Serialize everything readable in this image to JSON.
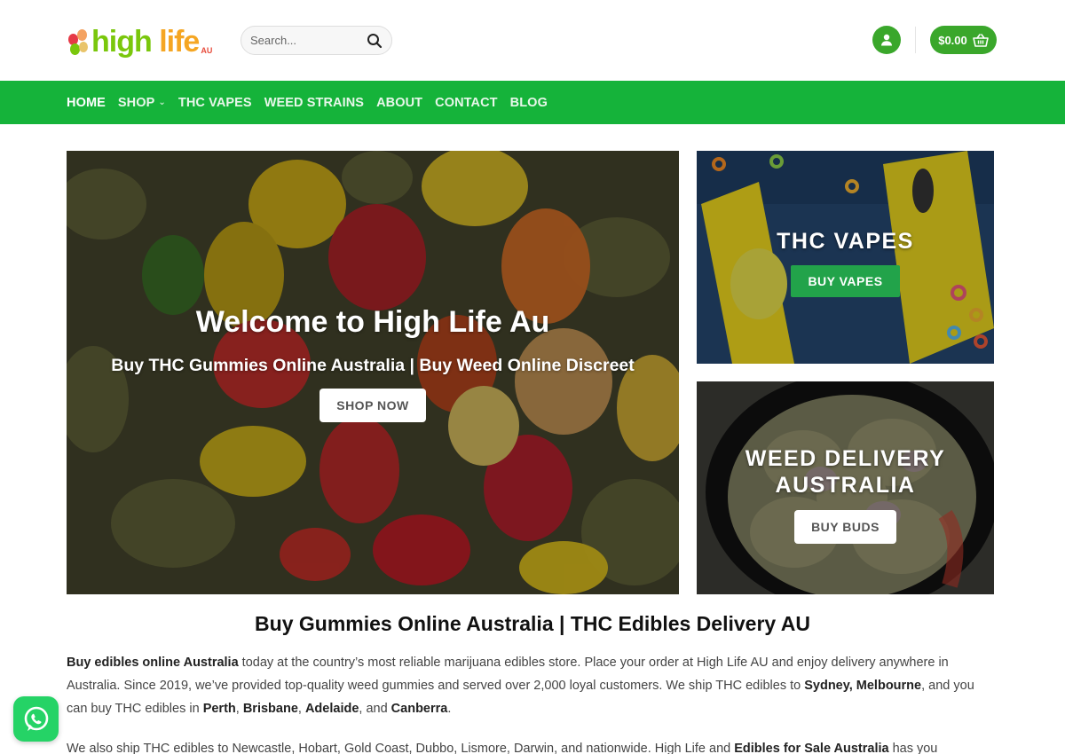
{
  "header": {
    "logo_text_high": "high",
    "logo_text_life": "life",
    "logo_au": "AU",
    "search_placeholder": "Search...",
    "cart_total": "$0.00"
  },
  "nav": {
    "items": [
      {
        "label": "HOME",
        "active": true
      },
      {
        "label": "SHOP",
        "has_dropdown": true
      },
      {
        "label": "THC VAPES"
      },
      {
        "label": "WEED STRAINS"
      },
      {
        "label": "ABOUT"
      },
      {
        "label": "CONTACT"
      },
      {
        "label": "BLOG"
      }
    ]
  },
  "hero": {
    "title": "Welcome to High Life Au",
    "subtitle": "Buy THC Gummies Online Australia | Buy Weed Online Discreet",
    "button": "SHOP NOW"
  },
  "side_banners": [
    {
      "title": "THC VAPES",
      "button": "BUY VAPES"
    },
    {
      "title_line1": "WEED DELIVERY",
      "title_line2": "AUSTRALIA",
      "button": "BUY BUDS"
    }
  ],
  "content": {
    "title": "Buy Gummies Online Australia | THC Edibles Delivery AU",
    "p1": {
      "s1": "Buy edibles online Australia",
      "s2": " today at the country’s most reliable marijuana edibles store. Place your order at High Life AU and enjoy delivery anywhere in Australia. Since 2019, we’ve provided top-quality weed gummies and served over 2,000 loyal customers. We ship THC edibles to ",
      "s3": "Sydney, Melbourne",
      "s4": ", and you can buy THC edibles in ",
      "s5": "Perth",
      "s6": ", ",
      "s7": "Brisbane",
      "s8": ", ",
      "s9": "Adelaide",
      "s10": ", and ",
      "s11": "Canberra",
      "s12": "."
    },
    "p2": {
      "s1": "We also ship THC edibles to Newcastle, Hobart, Gold Coast, Dubbo, Lismore, Darwin, and nationwide. High Life and ",
      "s2": "Edibles for Sale Australia",
      "s3": " has you"
    }
  },
  "colors": {
    "brand_green": "#3aa72b",
    "nav_green": "#15b33a",
    "button_green": "#22a34a",
    "whatsapp_green": "#25d366"
  },
  "icons": {
    "search": "search-icon",
    "account": "user-icon",
    "cart": "basket-icon",
    "nav_dropdown": "chevron-down-icon",
    "whatsapp": "whatsapp-icon"
  }
}
